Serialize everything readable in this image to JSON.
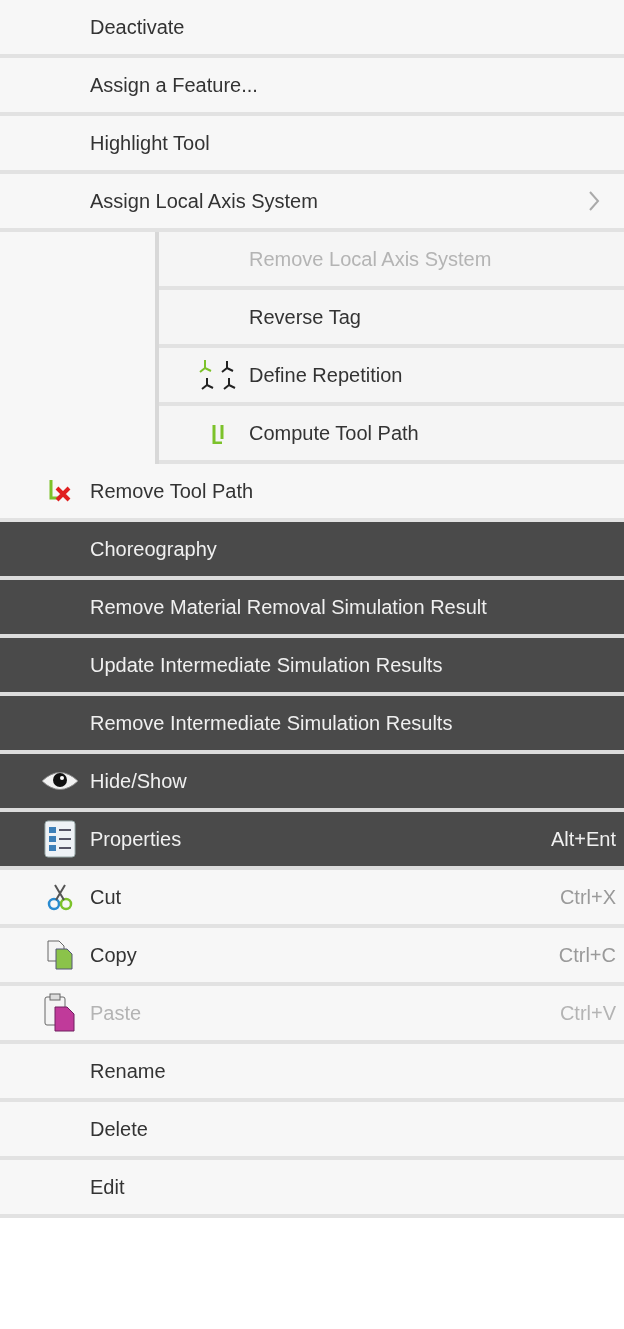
{
  "menus": [
    {
      "kind": "light",
      "items": [
        {
          "kind": "plain",
          "label": "Deactivate",
          "disabled": false
        },
        {
          "kind": "plain",
          "label": "Assign a Feature...",
          "disabled": false
        },
        {
          "kind": "plain",
          "label": "Highlight Tool",
          "disabled": false
        },
        {
          "kind": "plain",
          "label": "Assign Local Axis System",
          "disabled": false,
          "children": [
            {
              "kind": "plain",
              "label": "Remove Local Axis System",
              "disabled": true
            },
            {
              "kind": "plain",
              "label": "Reverse Tag",
              "disabled": false
            },
            {
              "kind": "repetition",
              "label": "Define Repetition",
              "disabled": false
            },
            {
              "kind": "toolpath",
              "label": "Compute Tool Path",
              "disabled": false
            }
          ]
        },
        {
          "kind": "removetoolpath",
          "label": "Remove Tool Path",
          "disabled": false
        }
      ]
    },
    {
      "kind": "dark",
      "items": [
        {
          "kind": "plain",
          "label": "Choreography",
          "disabled": false
        },
        {
          "kind": "plain",
          "label": "Remove Material Removal Simulation Result",
          "disabled": false
        },
        {
          "kind": "plain",
          "label": "Update Intermediate Simulation Results",
          "disabled": false
        },
        {
          "kind": "plain",
          "label": "Remove Intermediate Simulation Results",
          "disabled": false
        },
        {
          "kind": "eye",
          "label": "Hide/Show",
          "disabled": false
        },
        {
          "kind": "properties",
          "label": "Properties",
          "shortcut": "Alt+Ent",
          "disabled": false
        }
      ]
    },
    {
      "kind": "light",
      "items": [
        {
          "kind": "cut",
          "label": "Cut",
          "shortcut": "Ctrl+X",
          "disabled": false
        },
        {
          "kind": "copy",
          "label": "Copy",
          "shortcut": "Ctrl+C",
          "disabled": false
        },
        {
          "kind": "paste",
          "label": "Paste",
          "shortcut": "Ctrl+V",
          "disabled": true
        },
        {
          "kind": "plain",
          "label": "Rename",
          "disabled": false
        },
        {
          "kind": "plain",
          "label": "Delete",
          "disabled": false
        },
        {
          "kind": "plain",
          "label": "Edit",
          "disabled": false
        }
      ]
    }
  ]
}
